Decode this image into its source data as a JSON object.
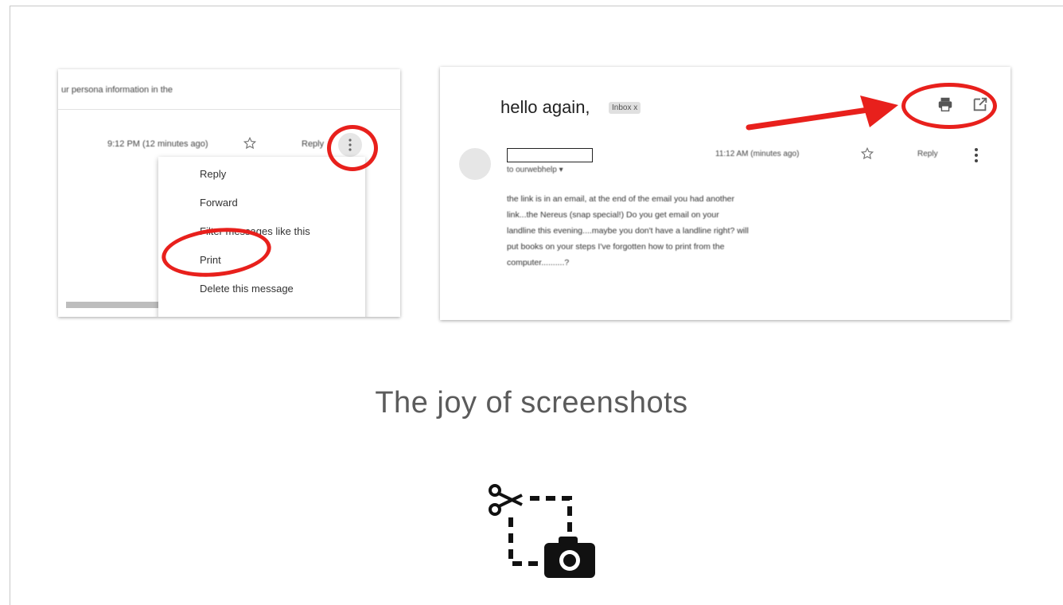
{
  "slide": {
    "title": "The joy of screenshots"
  },
  "left_shot": {
    "top_text": "ur persona  information in the",
    "time_text": "9:12 PM (12 minutes ago)",
    "reply_label": "Reply",
    "menu_items": [
      "Reply",
      "Forward",
      "Filter messages like this",
      "Print",
      "Delete this message"
    ]
  },
  "right_shot": {
    "subject": "hello again,",
    "label_chip": "Inbox x",
    "to_line": "to ourwebhelp ▾",
    "time_text": "11:12 AM (minutes ago)",
    "reply_label": "Reply",
    "body_lines": [
      "the link is in an email, at the end of the email you had another",
      "link...the Nereus (snap special!)   Do you get email on your",
      "landline this evening....maybe you don't have a landline right?  will",
      "put books on your steps  I've forgotten how to print from the",
      "computer..........?"
    ]
  },
  "colors": {
    "annotation_red": "#e8201c",
    "title_gray": "#5b5b5b"
  },
  "icons": {
    "screenshot": "scissors-camera-icon"
  }
}
